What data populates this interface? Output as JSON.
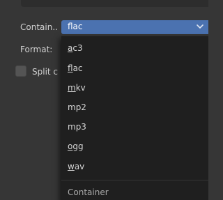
{
  "top_row": {
    "field_value": ""
  },
  "container_row": {
    "label": "Contain..",
    "selected": "flac"
  },
  "format_row": {
    "label": "Format:"
  },
  "split_row": {
    "label": "Split c",
    "checked": false
  },
  "dropdown": {
    "items": [
      {
        "label": "ac3",
        "shortcut": "a"
      },
      {
        "label": "flac",
        "shortcut": "f"
      },
      {
        "label": "mkv",
        "shortcut": "m"
      },
      {
        "label": "mp2",
        "shortcut": ""
      },
      {
        "label": "mp3",
        "shortcut": ""
      },
      {
        "label": "ogg",
        "shortcut": "o"
      },
      {
        "label": "wav",
        "shortcut": "w"
      }
    ],
    "title": "Container"
  },
  "colors": {
    "background": "#363636",
    "accent": "#4b72b0",
    "menu_background": "#1f1f1f",
    "field_background": "#2a2a2a"
  },
  "icons": {
    "select_arrow": "chevron-down-icon"
  }
}
